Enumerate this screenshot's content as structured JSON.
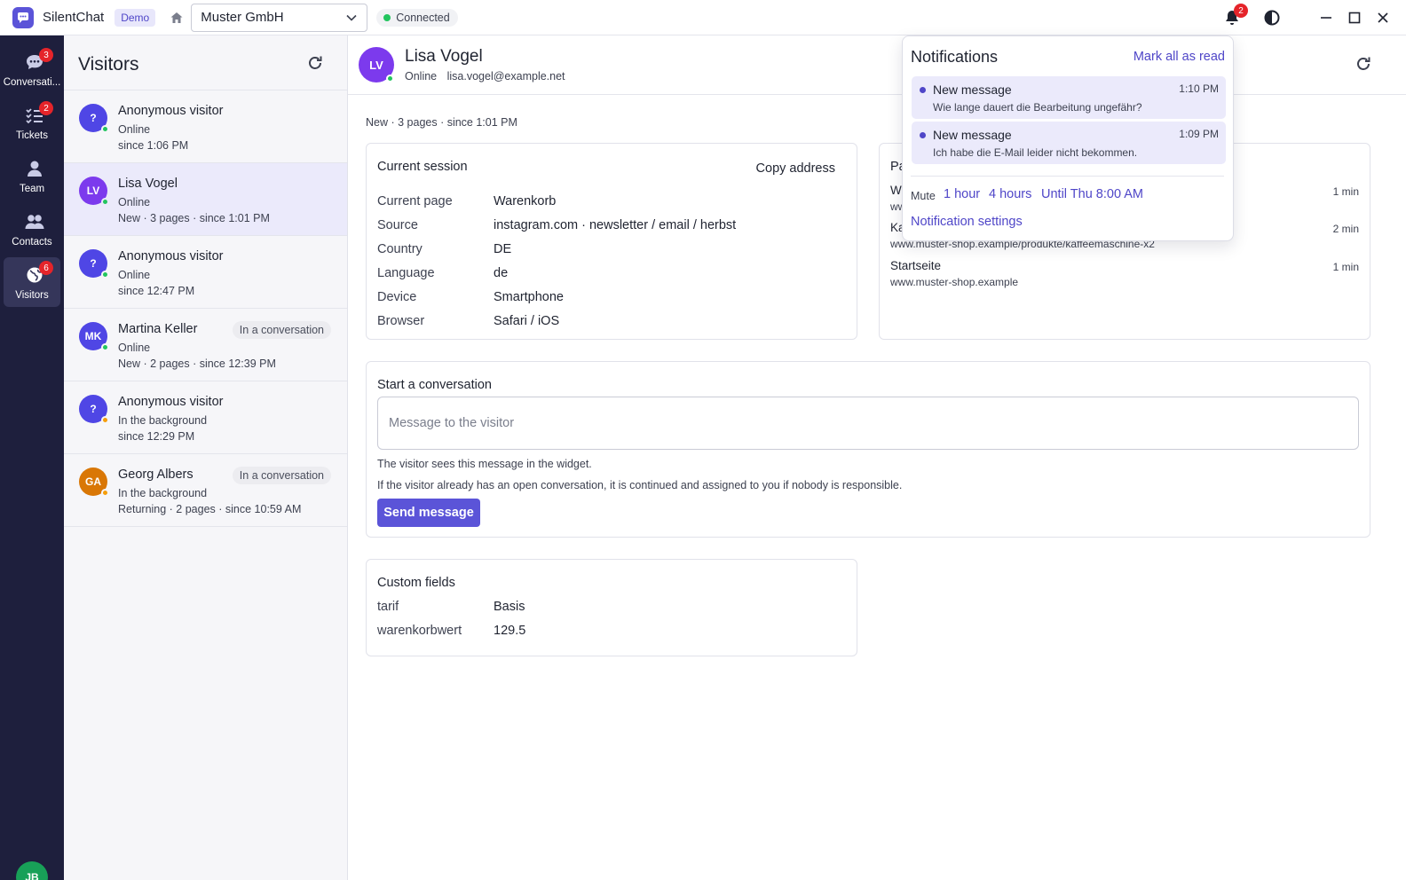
{
  "app": {
    "name": "SilentChat",
    "env_badge": "Demo"
  },
  "topbar": {
    "org": "Muster GmbH",
    "connection_status": "Connected",
    "notification_count": "2"
  },
  "nav": {
    "items": [
      {
        "label": "Conversati...",
        "badge": "3",
        "icon": "chat-bubble-icon"
      },
      {
        "label": "Tickets",
        "badge": "2",
        "icon": "checklist-icon"
      },
      {
        "label": "Team",
        "badge": "",
        "icon": "person-icon"
      },
      {
        "label": "Contacts",
        "badge": "",
        "icon": "people-icon"
      },
      {
        "label": "Visitors",
        "badge": "6",
        "icon": "globe-icon",
        "active": true
      }
    ],
    "user_initials": "JB"
  },
  "visitors": {
    "title": "Visitors",
    "items": [
      {
        "initials": "?",
        "name": "Anonymous visitor",
        "status": "Online",
        "meta": "since 1:06 PM",
        "tag": "",
        "avatar_color": "#4f46e5",
        "status_color": "#22c55e"
      },
      {
        "initials": "LV",
        "name": "Lisa Vogel",
        "status": "Online",
        "meta": "New · 3 pages · since 1:01 PM",
        "tag": "",
        "avatar_color": "#7c3aed",
        "status_color": "#22c55e"
      },
      {
        "initials": "?",
        "name": "Anonymous visitor",
        "status": "Online",
        "meta": "since 12:47 PM",
        "tag": "",
        "avatar_color": "#4f46e5",
        "status_color": "#22c55e"
      },
      {
        "initials": "MK",
        "name": "Martina Keller",
        "status": "Online",
        "meta": "New · 2 pages · since 12:39 PM",
        "tag": "In a conversation",
        "avatar_color": "#4f46e5",
        "status_color": "#22c55e"
      },
      {
        "initials": "?",
        "name": "Anonymous visitor",
        "status": "In the background",
        "meta": "since 12:29 PM",
        "tag": "",
        "avatar_color": "#4f46e5",
        "status_color": "#f59e0b"
      },
      {
        "initials": "GA",
        "name": "Georg Albers",
        "status": "In the background",
        "meta": "Returning · 2 pages · since 10:59 AM",
        "tag": "In a conversation",
        "avatar_color": "#d97706",
        "status_color": "#f59e0b"
      }
    ]
  },
  "detail": {
    "initials": "LV",
    "name": "Lisa Vogel",
    "status": "Online",
    "email": "lisa.vogel@example.net",
    "meta": "New · 3 pages · since 1:01 PM",
    "session": {
      "title": "Current session",
      "copy_label": "Copy address",
      "rows": [
        {
          "key": "Current page",
          "value": "Warenkorb"
        },
        {
          "key": "Source",
          "value": "instagram.com · newsletter / email / herbst"
        },
        {
          "key": "Country",
          "value": "DE"
        },
        {
          "key": "Language",
          "value": "de"
        },
        {
          "key": "Device",
          "value": "Smartphone"
        },
        {
          "key": "Browser",
          "value": "Safari / iOS"
        }
      ]
    },
    "pages": {
      "title_partial": "Pa",
      "items": [
        {
          "title": "W",
          "url": "ww",
          "duration": "1 min"
        },
        {
          "title": "Ka",
          "url": "www.muster-shop.example/produkte/kaffeemaschine-x2",
          "duration": "2 min"
        },
        {
          "title": "Startseite",
          "url": "www.muster-shop.example",
          "duration": "1 min"
        }
      ]
    },
    "start_conversation": {
      "title": "Start a conversation",
      "placeholder": "Message to the visitor",
      "hint1": "The visitor sees this message in the widget.",
      "hint2": "If the visitor already has an open conversation, it is continued and assigned to you if nobody is responsible.",
      "send_label": "Send message"
    },
    "custom_fields": {
      "title": "Custom fields",
      "rows": [
        {
          "key": "tarif",
          "value": "Basis"
        },
        {
          "key": "warenkorbwert",
          "value": "129.5"
        }
      ]
    }
  },
  "notifications": {
    "title": "Notifications",
    "mark_all": "Mark all as read",
    "items": [
      {
        "title": "New message",
        "body": "Wie lange dauert die Bearbeitung ungefähr?",
        "time": "1:10 PM"
      },
      {
        "title": "New message",
        "body": "Ich habe die E-Mail leider nicht bekommen.",
        "time": "1:09 PM"
      }
    ],
    "mute_label": "Mute",
    "mute_options": [
      "1 hour",
      "4 hours",
      "Until Thu 8:00 AM"
    ],
    "settings_label": "Notification settings"
  },
  "colors": {
    "accent": "#5b54d8",
    "nav_bg": "#1e1f3d",
    "badge_red": "#e5242a",
    "online": "#22c55e",
    "background_status": "#f59e0b"
  }
}
